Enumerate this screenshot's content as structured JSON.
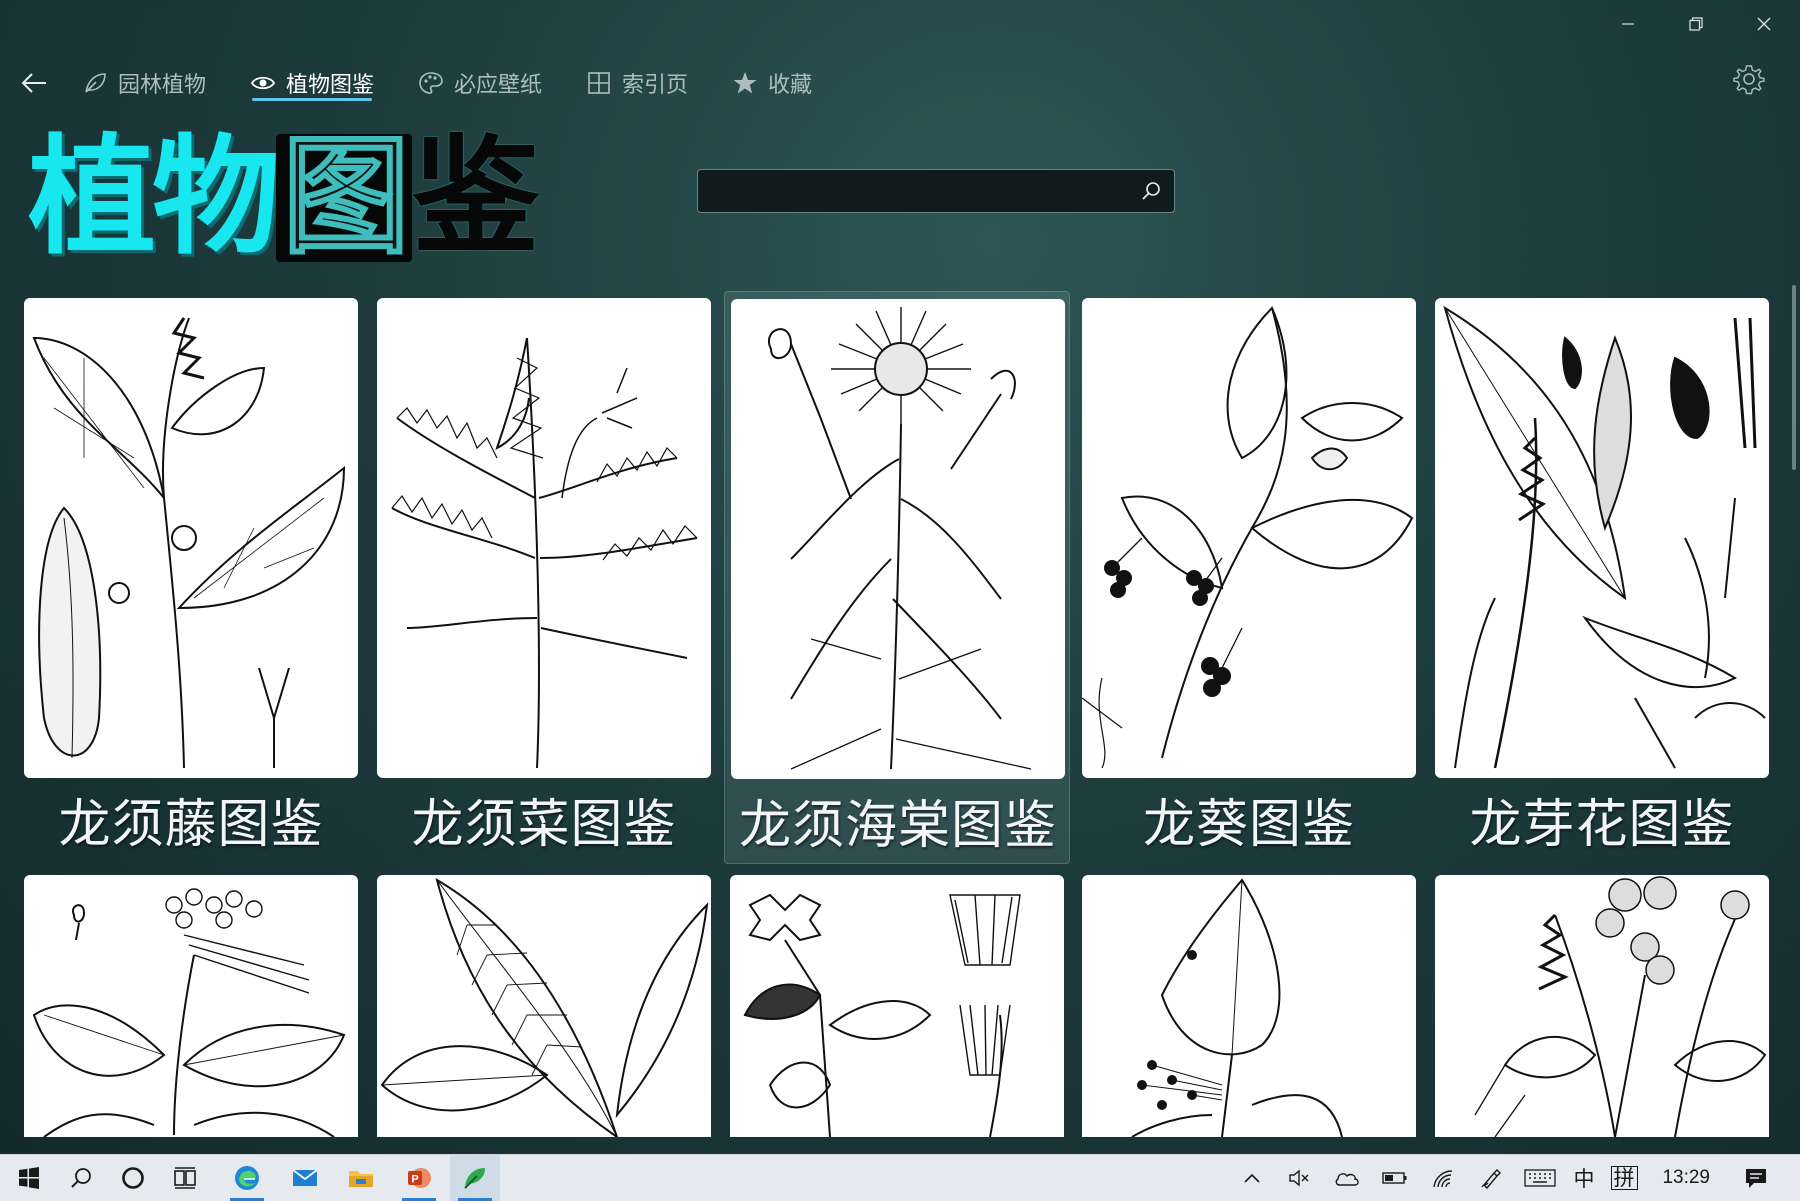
{
  "window": {
    "controls": {
      "minimize": "—",
      "restore": "❐",
      "close": "✕"
    }
  },
  "nav": {
    "back_icon": "back-arrow-icon",
    "tabs": [
      {
        "label": "园林植物",
        "icon": "leaf-icon",
        "active": false
      },
      {
        "label": "植物图鉴",
        "icon": "eye-icon",
        "active": true
      },
      {
        "label": "必应壁纸",
        "icon": "palette-icon",
        "active": false
      },
      {
        "label": "索引页",
        "icon": "grid-icon",
        "active": false
      },
      {
        "label": "收藏",
        "icon": "star-icon",
        "active": false
      }
    ],
    "settings_icon": "gear-icon"
  },
  "hero": {
    "part1": "植物",
    "part2": "图",
    "part3": "鉴"
  },
  "search": {
    "value": "",
    "placeholder": "",
    "icon": "search-icon"
  },
  "cards": [
    {
      "caption": "龙须藤图鉴",
      "illustration": "vine-with-pod"
    },
    {
      "caption": "龙须菜图鉴",
      "illustration": "feathery-plume"
    },
    {
      "caption": "龙须海棠图鉴",
      "illustration": "aster-flower"
    },
    {
      "caption": "龙葵图鉴",
      "illustration": "nightshade-branch"
    },
    {
      "caption": "龙芽花图鉴",
      "illustration": "leaf-and-spike"
    },
    {
      "caption": "",
      "illustration": "flower-cluster-leaves"
    },
    {
      "caption": "",
      "illustration": "long-leaves"
    },
    {
      "caption": "",
      "illustration": "tubular-flowers"
    },
    {
      "caption": "",
      "illustration": "heart-leaf-berries"
    },
    {
      "caption": "",
      "illustration": "berry-spike"
    }
  ],
  "taskbar": {
    "apps": [
      "windows-start-icon",
      "search-icon",
      "cortana-icon",
      "task-view-icon",
      "edge-icon",
      "mail-icon",
      "file-explorer-icon",
      "powerpoint-icon",
      "plant-app-icon"
    ],
    "tray": {
      "chevron": "^",
      "ime_lang": "中",
      "ime_mode": "拼",
      "time": "13:29"
    }
  },
  "colors": {
    "accent": "#5ec4e8",
    "hero_cyan": "#18e7f0",
    "background": "#1d3b3d"
  }
}
